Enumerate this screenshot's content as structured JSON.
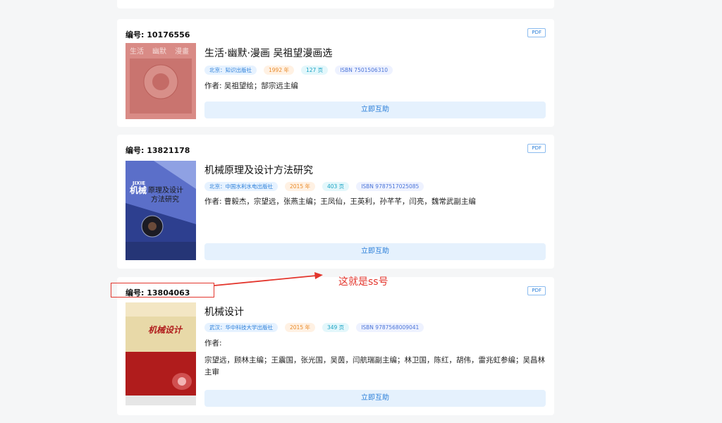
{
  "books": [
    {
      "number": "编号: 10176556",
      "pdf": "PDF",
      "title": "生活·幽默·漫画 吴祖望漫画选",
      "publisher": "北京：知识出版社",
      "year": "1992 年",
      "pages": "127 页",
      "isbn": "ISBN 7501506310",
      "author_prefix": "作者:",
      "author": "吴祖望绘；郜宗远主编",
      "button": "立即互助",
      "cover_text": [
        "生活",
        "幽默",
        "漫畫"
      ]
    },
    {
      "number": "编号: 13821178",
      "pdf": "PDF",
      "title": "机械原理及设计方法研究",
      "publisher": "北京：中国水利水电出版社",
      "year": "2015 年",
      "pages": "403 页",
      "isbn": "ISBN 9787517025085",
      "author_prefix": "作者:",
      "author": "曹毅杰，宗望远，张燕主编；王凤仙，王英利，孙芊芊，闫亮，魏常武副主编",
      "button": "立即互助",
      "cover_text": [
        "JIXIE",
        "机械",
        "原理及设计",
        "方法研究"
      ]
    },
    {
      "number": "编号: 13804063",
      "pdf": "PDF",
      "title": "机械设计",
      "publisher": "武汉：华中科技大学出版社",
      "year": "2015 年",
      "pages": "349 页",
      "isbn": "ISBN 9787568009041",
      "author_prefix": "作者:",
      "author": "宗望远，顾林主编；王震国，张光国，吴茵，闫航瑞副主编；林卫国，陈红，胡伟，雷兆虹参编；吴昌林主审",
      "button": "立即互助",
      "cover_text": [
        "机械设计"
      ]
    }
  ],
  "annotation": {
    "text": "这就是ss号",
    "color": "#e3362d"
  }
}
